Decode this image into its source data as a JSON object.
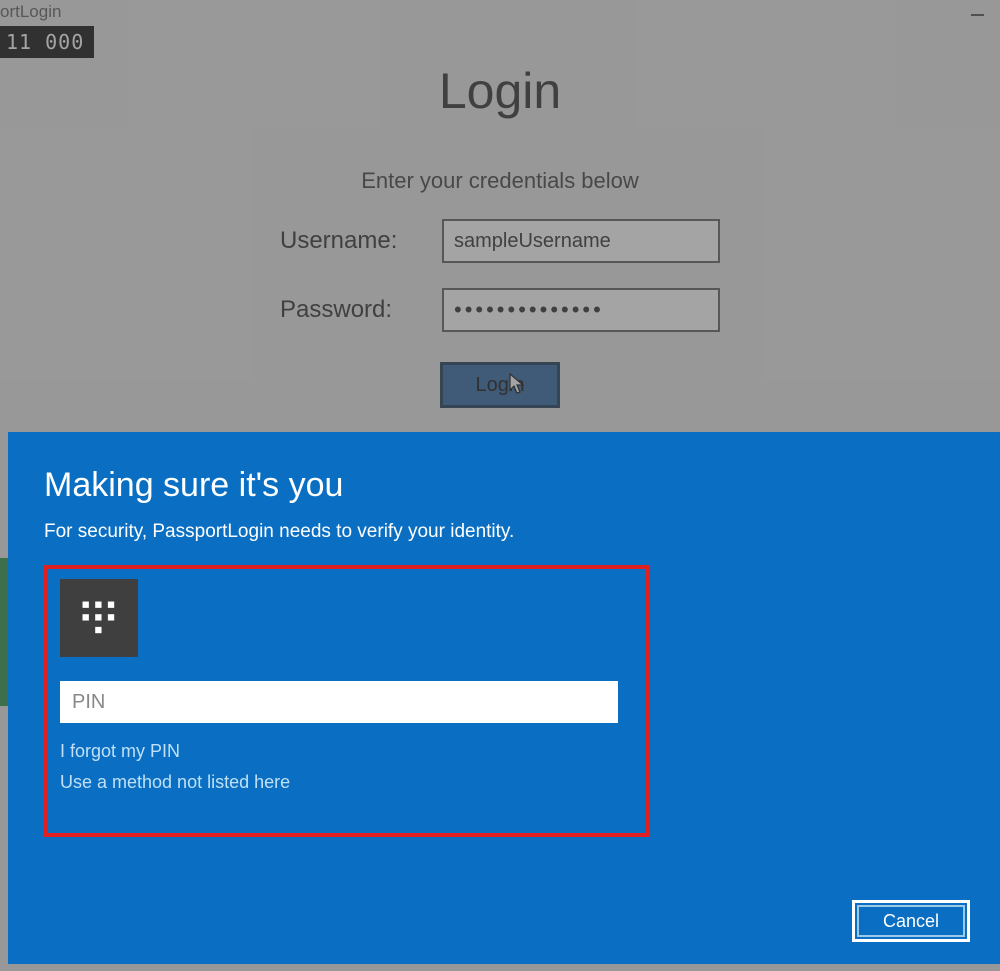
{
  "window": {
    "title_fragment": "ortLogin",
    "status_readout": "11  000"
  },
  "login_form": {
    "title": "Login",
    "subtitle": "Enter your credentials below",
    "username_label": "Username:",
    "username_value": "sampleUsername",
    "password_label": "Password:",
    "password_value": "••••••••••••••",
    "login_button": "Login"
  },
  "dialog": {
    "title": "Making sure it's you",
    "subtitle": "For security, PassportLogin needs to verify your identity.",
    "pin_placeholder": "PIN",
    "forgot_link": "I forgot my PIN",
    "alt_method_link": "Use a method not listed here",
    "cancel_button": "Cancel"
  }
}
